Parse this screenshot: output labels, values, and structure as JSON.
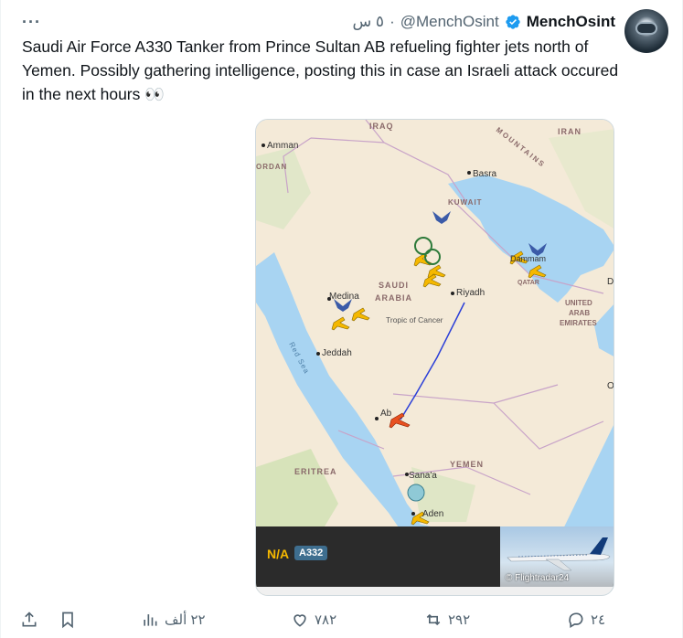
{
  "tweet": {
    "display_name": "MenchOsint",
    "handle": "@MenchOsint",
    "separator": "·",
    "time_ago": "٥ س",
    "more_icon": "more-horizontal-icon",
    "text": "Saudi Air Force A330 Tanker from Prince Sultan AB refueling fighter jets north of Yemen. Possibly gathering intelligence, posting this in case an Israeli attack occured in the next hours 👀"
  },
  "map": {
    "labels": {
      "iraq": "IRAQ",
      "iran": "IRAN",
      "amman": "Amman",
      "jordan": "ORDAN",
      "basra": "Basra",
      "kuwait": "KUWAIT",
      "mountains": "MOUNTAINS",
      "saudi": "SAUDI",
      "arabia": "ARABIA",
      "riyadh": "Riyadh",
      "medina": "Medina",
      "jeddah": "Jeddah",
      "tropic": "Tropic of Cancer",
      "red_sea": "Red Sea",
      "uae1": "UNITED",
      "uae2": "ARAB",
      "uae3": "EMIRATES",
      "qatar": "QATAR",
      "dammam": "Dammam",
      "eritrea": "ERITREA",
      "yemen": "YEMEN",
      "sanaa": "Sana'a",
      "aden": "Aden",
      "abha": "Ab",
      "d_edge": "D",
      "o_edge": "O"
    }
  },
  "flight": {
    "callsign": "N/A",
    "aircraft_type": "A332",
    "photo_credit": "© Flightradar24"
  },
  "actions": {
    "reply_count": "٢٤",
    "retweet_count": "٢٩٢",
    "like_count": "٧٨٢",
    "views_count": "٢٢ ألف"
  },
  "colors": {
    "verified": "#1d9bf0",
    "aircraft": "#f5b800",
    "route": "#2b3fd8",
    "sea": "#a8d4f2",
    "land": "#f4ead8"
  }
}
